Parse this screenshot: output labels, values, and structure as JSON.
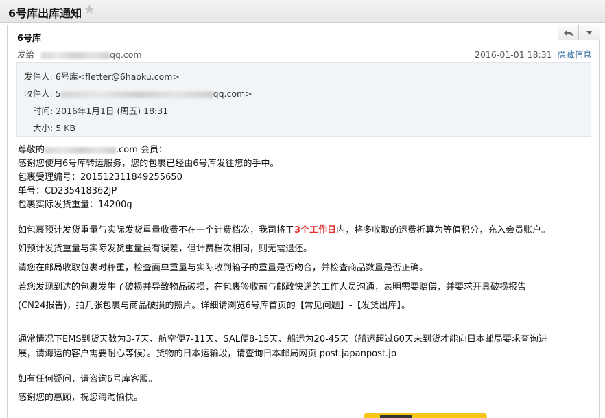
{
  "window": {
    "title": "6号库出库通知",
    "star_icon": "star-icon"
  },
  "message": {
    "sender_name": "6号库",
    "to_label": "发给",
    "to_suffix": "qq.com",
    "date": "2016-01-01 18:31",
    "hide_info_label": "隐藏信息",
    "reply_icon": "reply-icon",
    "more_icon": "chevron-down-icon"
  },
  "details": {
    "from_label": "发件人:",
    "from_value": "6号库<fletter@6haoku.com>",
    "to_label": "收件人:",
    "to_prefix": "5",
    "to_suffix": "qq.com>",
    "time_label": "时间:",
    "time_value": "2016年1月1日 (周五) 18:31",
    "size_label": "大小:",
    "size_value": "5 KB"
  },
  "body": {
    "greeting_prefix": "尊敬的",
    "greeting_suffix": ".com 会员：",
    "line1": "感谢您使用6号库转运服务，您的包裹已经由6号库发往您的手中。",
    "line2": "包裹受理编号：201512311849255650",
    "line3": "单号：CD235418362JP",
    "line4": "包裹实际发货重量：14200g",
    "para1_a": "如包裹预计发货重量与实际发货重量收费不在一个计费档次，我司将于",
    "para1_red": "3个工作日",
    "para1_b": "内，将多收取的运费折算为等值积分，充入会员账户。",
    "para2": "如预计发货重量与实际发货重量虽有误差，但计费档次相同，则无需退还。",
    "para3": "请您在邮局收取包裹时秤重，检查面单重量与实际收到箱子的重量是否吻合，并检查商品数量是否正确。",
    "para4_a": "若您发现到达的包裹发生了破损并导致物品破损，在包裹签收前与邮政快递的工作人员沟通，表明需要赔偿，并要求开具破损报告",
    "para4_b": "(CN24报告)，拍几张包裹与商品破损的照片。详细请浏览6号库首页的【常见问题】-【发货出库】。",
    "para5_a": "通常情况下EMS到货天数为3-7天、航空便7-11天、SAL便8-15天、船运为20-45天（船运超过60天未到货才能向日本邮局要求查询进",
    "para5_b": "展，请海运的客户需要耐心等候）。货物的日本运输段，请查询日本邮局网页 post.japanpost.jp",
    "para6": "如有任何疑问，请咨询6号库客服。",
    "para7": "感谢您的惠顾，祝您海淘愉快。"
  }
}
